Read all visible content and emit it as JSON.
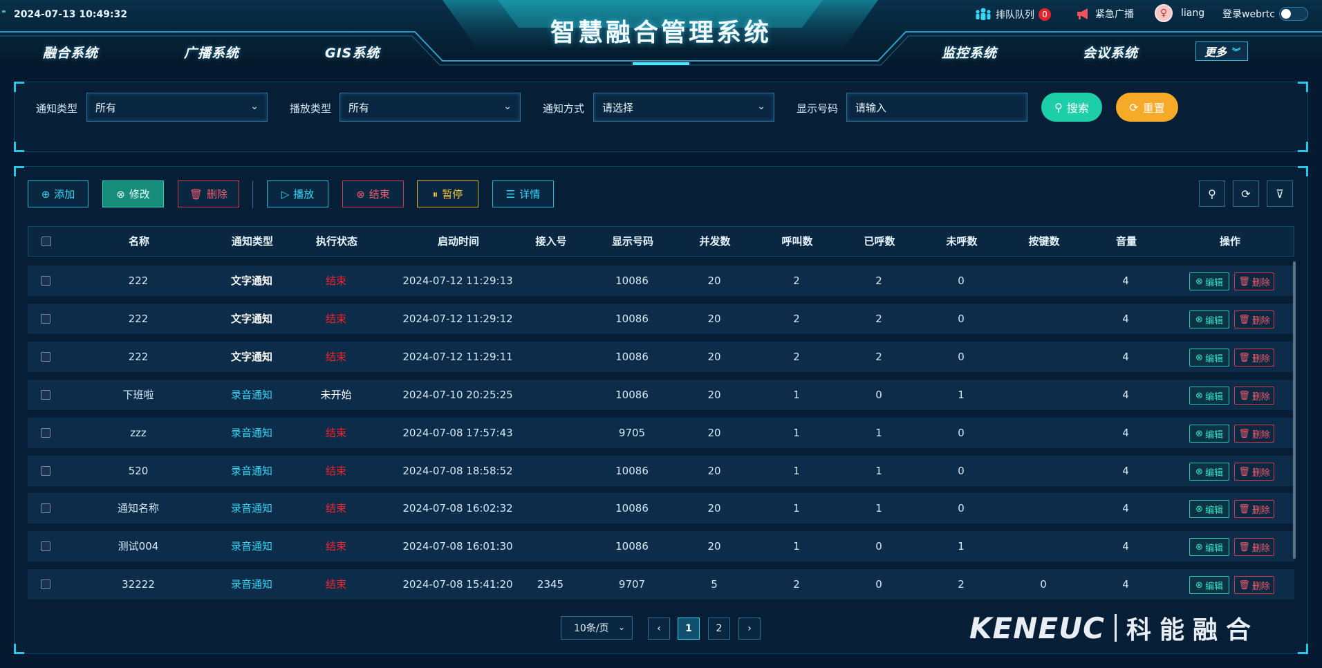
{
  "header": {
    "datetime": "2024-07-13 10:49:32",
    "title": "智慧融合管理系统",
    "nav_left": [
      "融合系统",
      "广播系统",
      "GIS系统"
    ],
    "nav_right": [
      "监控系统",
      "会议系统"
    ],
    "more_label": "更多",
    "queue_label": "排队队列",
    "queue_count": "0",
    "broadcast_label": "紧急广播",
    "username": "liang",
    "webrtc_label": "登录webrtc",
    "webrtc_enabled": false
  },
  "filters": {
    "notice_type_label": "通知类型",
    "notice_type_value": "所有",
    "play_type_label": "播放类型",
    "play_type_value": "所有",
    "notice_mode_label": "通知方式",
    "notice_mode_placeholder": "请选择",
    "display_number_label": "显示号码",
    "display_number_placeholder": "请输入",
    "search_label": "搜索",
    "reset_label": "重置"
  },
  "toolbar": {
    "add": "添加",
    "edit": "修改",
    "delete": "删除",
    "play": "播放",
    "end": "结束",
    "pause": "暂停",
    "detail": "详情"
  },
  "table": {
    "headers": [
      "名称",
      "通知类型",
      "执行状态",
      "启动时间",
      "接入号",
      "显示号码",
      "并发数",
      "呼叫数",
      "已呼数",
      "未呼数",
      "按键数",
      "音量",
      "操作"
    ],
    "edit_label": "编辑",
    "delete_label": "删除",
    "rows": [
      {
        "name": "222",
        "type": "文字通知",
        "status": "结束",
        "start": "2024-07-12 11:29:13",
        "access": "",
        "display": "10086",
        "concurrency": "20",
        "calls": "2",
        "called": "2",
        "uncalled": "0",
        "keys": "",
        "volume": "4"
      },
      {
        "name": "222",
        "type": "文字通知",
        "status": "结束",
        "start": "2024-07-12 11:29:12",
        "access": "",
        "display": "10086",
        "concurrency": "20",
        "calls": "2",
        "called": "2",
        "uncalled": "0",
        "keys": "",
        "volume": "4"
      },
      {
        "name": "222",
        "type": "文字通知",
        "status": "结束",
        "start": "2024-07-12 11:29:11",
        "access": "",
        "display": "10086",
        "concurrency": "20",
        "calls": "2",
        "called": "2",
        "uncalled": "0",
        "keys": "",
        "volume": "4"
      },
      {
        "name": "下班啦",
        "type": "录音通知",
        "status": "未开始",
        "start": "2024-07-10 20:25:25",
        "access": "",
        "display": "10086",
        "concurrency": "20",
        "calls": "1",
        "called": "0",
        "uncalled": "1",
        "keys": "",
        "volume": "4"
      },
      {
        "name": "zzz",
        "type": "录音通知",
        "status": "结束",
        "start": "2024-07-08 17:57:43",
        "access": "",
        "display": "9705",
        "concurrency": "20",
        "calls": "1",
        "called": "1",
        "uncalled": "0",
        "keys": "",
        "volume": "4"
      },
      {
        "name": "520",
        "type": "录音通知",
        "status": "结束",
        "start": "2024-07-08 18:58:52",
        "access": "",
        "display": "10086",
        "concurrency": "20",
        "calls": "1",
        "called": "1",
        "uncalled": "0",
        "keys": "",
        "volume": "4"
      },
      {
        "name": "通知名称",
        "type": "录音通知",
        "status": "结束",
        "start": "2024-07-08 16:02:32",
        "access": "",
        "display": "10086",
        "concurrency": "20",
        "calls": "1",
        "called": "1",
        "uncalled": "0",
        "keys": "",
        "volume": "4"
      },
      {
        "name": "测试004",
        "type": "录音通知",
        "status": "结束",
        "start": "2024-07-08 16:01:30",
        "access": "",
        "display": "10086",
        "concurrency": "20",
        "calls": "1",
        "called": "0",
        "uncalled": "1",
        "keys": "",
        "volume": "4"
      },
      {
        "name": "32222",
        "type": "录音通知",
        "status": "结束",
        "start": "2024-07-08 15:41:20",
        "access": "2345",
        "display": "9707",
        "concurrency": "5",
        "calls": "2",
        "called": "0",
        "uncalled": "2",
        "keys": "0",
        "volume": "4"
      }
    ]
  },
  "pagination": {
    "page_size": "10条/页",
    "pages": [
      "1",
      "2"
    ],
    "current": "1"
  },
  "brand": {
    "english": "KENEUC",
    "chinese": "科能融合"
  },
  "colors": {
    "accent_cyan": "#35d7f5",
    "accent_green": "#1ccfa8",
    "accent_orange": "#f7a928",
    "status_end": "#f0252f",
    "danger": "#d13b52"
  }
}
